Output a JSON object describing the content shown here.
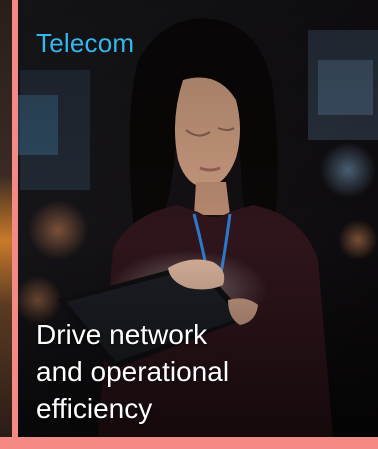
{
  "card": {
    "category": "Telecom",
    "headline_lines": [
      "Drive network",
      "and operational",
      "efficiency"
    ],
    "image_subject": "woman-using-tablet-photo"
  },
  "colors": {
    "frame": "#f48a86",
    "category_text": "#35b6ec",
    "headline_text": "#ffffff",
    "card_background": "#0e0c0d"
  }
}
